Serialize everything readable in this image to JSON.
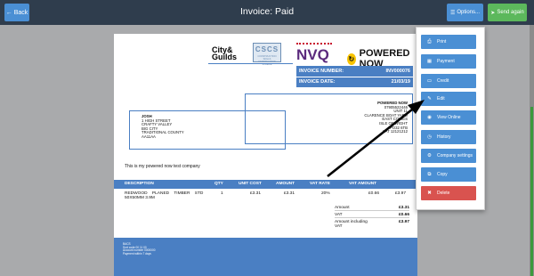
{
  "topbar": {
    "back_label": "Back",
    "title": "Invoice: Paid",
    "options_label": "Options...",
    "send_label": "Send again"
  },
  "invoice": {
    "number_label": "INVOICE NUMBER:",
    "number_value": "INV000076",
    "date_label": "INVOICE DATE:",
    "date_value": "21/03/19",
    "company_lines": [
      "POWERED NOW",
      "07905522446",
      "UNIT 11",
      "CLARENCE BOAT YARD",
      "EAST COWES",
      "ISLE OF WIGHT",
      "PO32 6TB",
      "VAT 12121212"
    ],
    "customer_lines": [
      "JOSH",
      "1 HIGH STREET",
      "CRAFTY VALLEY",
      "BIG CITY",
      "TRADITIONAL COUNTY",
      "AA11AA"
    ],
    "note": "This is my powered now test company",
    "table": {
      "headers": {
        "description": "DESCRIPTION",
        "qty": "QTY",
        "unit_cost": "UNIT COST",
        "amount": "AMOUNT",
        "vat_rate": "VAT RATE",
        "vat_amount": "VAT AMOUNT"
      },
      "row": {
        "description_line1": "REDWOOD    PLANED    TIMBER    STD",
        "description_line2": "50X50MM 3.9M",
        "qty": "1",
        "unit_cost": "£3.31",
        "amount": "£3.31",
        "vat_rate": "20%",
        "vat_amount": "£0.66",
        "total": "£3.97"
      }
    },
    "totals": [
      {
        "label": "Amount",
        "value": "£3.31"
      },
      {
        "label": "VAT",
        "value": "£0.66"
      },
      {
        "label": "Amount including VAT",
        "value": "£3.97"
      }
    ],
    "footer_lines": [
      "BACS",
      "Sort code 00 11 00",
      "Account number 0000000",
      "Payment within 7 days"
    ]
  },
  "logos": {
    "cg_line1": "City&",
    "cg_line2": "Guilds",
    "cscs": "CSCS",
    "cscs_sub": "CONSTRUCTION SKILLS CERTIFICATION SCHEME",
    "nvq": "NVQ",
    "powered_now": "POWERED NOW"
  },
  "menu": {
    "items": [
      {
        "label": "Print",
        "icon": "print-icon"
      },
      {
        "label": "Payment",
        "icon": "payment-icon"
      },
      {
        "label": "Credit",
        "icon": "credit-card-icon"
      },
      {
        "label": "Edit",
        "icon": "edit-icon"
      },
      {
        "label": "View Online",
        "icon": "eye-icon"
      },
      {
        "label": "History",
        "icon": "history-icon"
      },
      {
        "label": "Company settings",
        "icon": "gear-icon"
      },
      {
        "label": "Copy",
        "icon": "copy-icon"
      },
      {
        "label": "Delete",
        "icon": "trash-icon"
      }
    ]
  },
  "colors": {
    "topbar": "#2f3d4d",
    "primary": "#4a8fd4",
    "invoice_blue": "#4a7fc3",
    "success": "#5cb85c",
    "danger": "#d9534f"
  }
}
